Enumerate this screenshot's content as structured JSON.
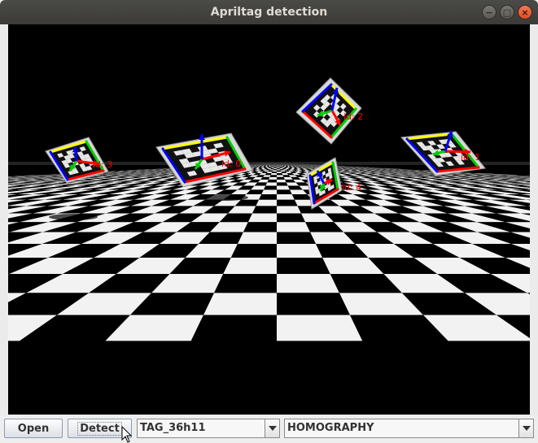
{
  "window": {
    "title": "Apriltag detection"
  },
  "window_controls": {
    "minimize": "−",
    "maximize": "□",
    "close": "×"
  },
  "toolbar": {
    "open_label": "Open",
    "detect_label": "Detect",
    "tag_family": "TAG_36h11",
    "pose_method": "HOMOGRAPHY"
  },
  "tags": [
    {
      "label": "id: 3"
    },
    {
      "label": "id: 0"
    },
    {
      "label": "id: 2"
    },
    {
      "label": "id: 1"
    },
    {
      "label": "id: 4"
    }
  ],
  "colors": {
    "axis_x": "#ff0000",
    "axis_y": "#00cc00",
    "axis_z": "#0000ff",
    "edge_top": "#ffff00",
    "label": "#ff0000"
  }
}
